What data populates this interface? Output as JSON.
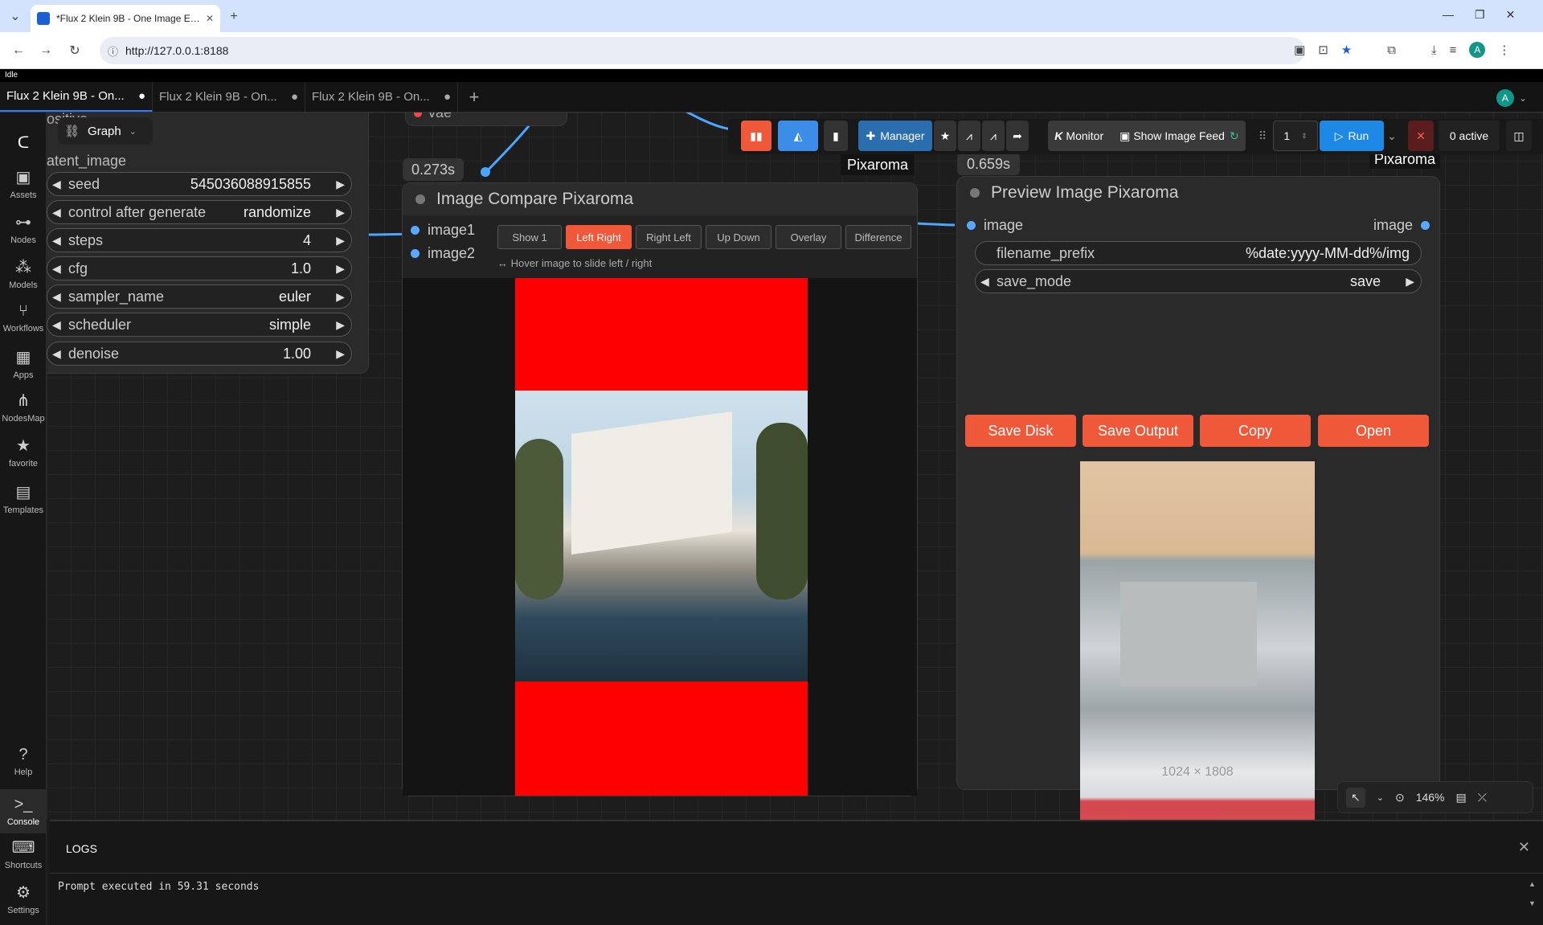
{
  "browser": {
    "tab_title": "*Flux 2 Klein 9B - One Image E…",
    "url": "http://127.0.0.1:8188",
    "status": "Idle",
    "avatar": "A"
  },
  "workflow_tabs": [
    "Flux 2 Klein 9B - On...",
    "Flux 2 Klein 9B - On...",
    "Flux 2 Klein 9B - On..."
  ],
  "topbar": {
    "graph_label": "Graph",
    "manager": "Manager",
    "monitor": "Monitor",
    "show_feed": "Show Image Feed",
    "batch": "1",
    "run": "Run",
    "active": "0 active"
  },
  "sidebar": [
    "Assets",
    "Nodes",
    "Models",
    "Workflows",
    "Apps",
    "NodesMap",
    "favorite",
    "Templates"
  ],
  "sidebar_bottom": [
    "Help",
    "Console",
    "Shortcuts",
    "Settings"
  ],
  "ksampler": {
    "partial_top": "ositive",
    "partial_latent": "atent_image",
    "widgets": [
      {
        "label": "seed",
        "value": "545036088915855"
      },
      {
        "label": "control after generate",
        "value": "randomize"
      },
      {
        "label": "steps",
        "value": "4"
      },
      {
        "label": "cfg",
        "value": "1.0"
      },
      {
        "label": "sampler_name",
        "value": "euler"
      },
      {
        "label": "scheduler",
        "value": "simple"
      },
      {
        "label": "denoise",
        "value": "1.00"
      }
    ]
  },
  "vae_label": "vae",
  "compare": {
    "time": "0.273s",
    "title": "Image Compare Pixaroma",
    "inputs": [
      "image1",
      "image2"
    ],
    "modes": [
      "Show 1",
      "Left Right",
      "Right Left",
      "Up Down",
      "Overlay",
      "Difference"
    ],
    "active_mode": "Left Right",
    "hint": "↔ Hover image to slide left / right"
  },
  "pixaroma_tag": "Pixaroma",
  "preview": {
    "time": "0.659s",
    "tag": "Pixaroma",
    "title": "Preview Image Pixaroma",
    "input": "image",
    "output": "image",
    "filename_prefix": {
      "label": "filename_prefix",
      "value": "%date:yyyy-MM-dd%/img"
    },
    "save_mode": {
      "label": "save_mode",
      "value": "save"
    },
    "buttons": [
      "Save Disk",
      "Save Output",
      "Copy",
      "Open"
    ],
    "dims": "1024 × 1808"
  },
  "canvas_controls": {
    "zoom": "146%"
  },
  "logs": {
    "title": "LOGS",
    "line": "Prompt executed in 59.31 seconds"
  }
}
